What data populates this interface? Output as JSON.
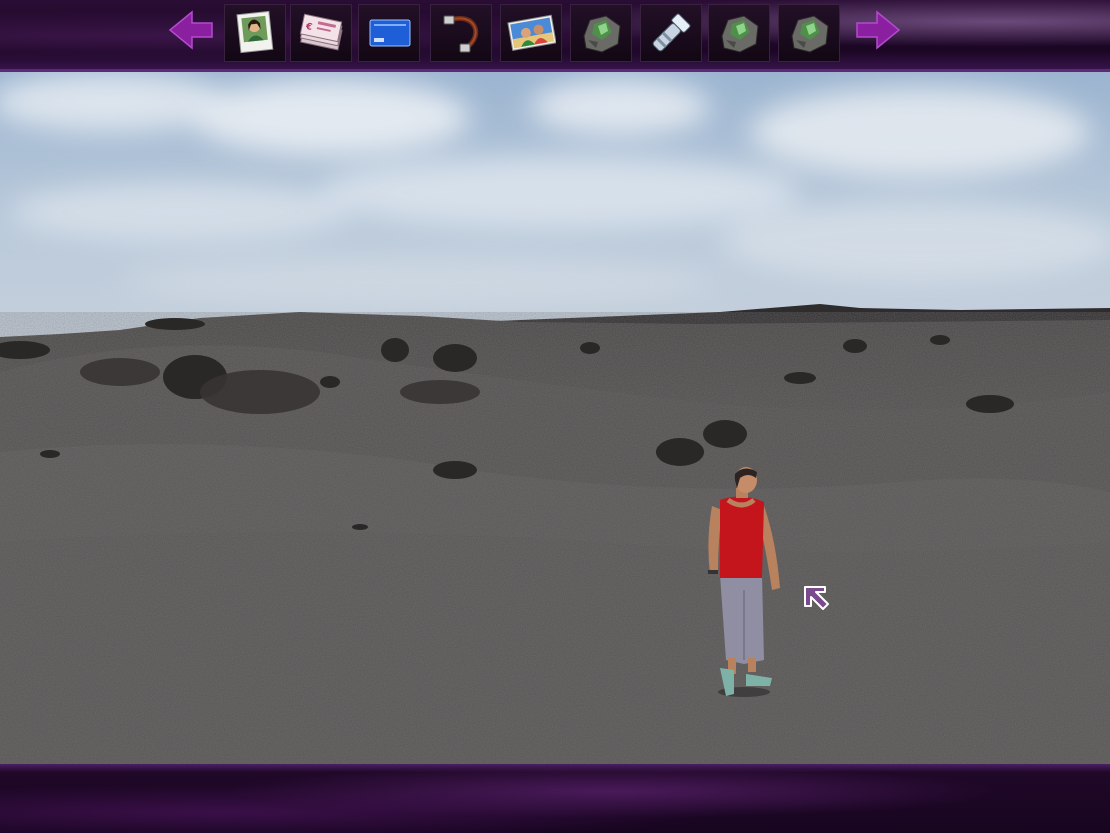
{
  "toolbar": {
    "prev": {
      "icon": "arrow-left-icon",
      "color": "#8a1fa0"
    },
    "next": {
      "icon": "arrow-right-icon",
      "color": "#8a1fa0"
    },
    "items": [
      {
        "icon": "photo-portrait-icon"
      },
      {
        "icon": "banknotes-icon"
      },
      {
        "icon": "blue-card-icon"
      },
      {
        "icon": "cable-icon"
      },
      {
        "icon": "holiday-photo-icon"
      },
      {
        "icon": "green-crystal-rock-icon"
      },
      {
        "icon": "flashlight-icon"
      },
      {
        "icon": "green-crystal-rock-icon"
      },
      {
        "icon": "green-crystal-rock-icon"
      }
    ]
  },
  "scene": {
    "location": "volcanic-plain",
    "character_shirt_color": "#c4141c",
    "character_trousers_color": "#8f8ea3"
  }
}
